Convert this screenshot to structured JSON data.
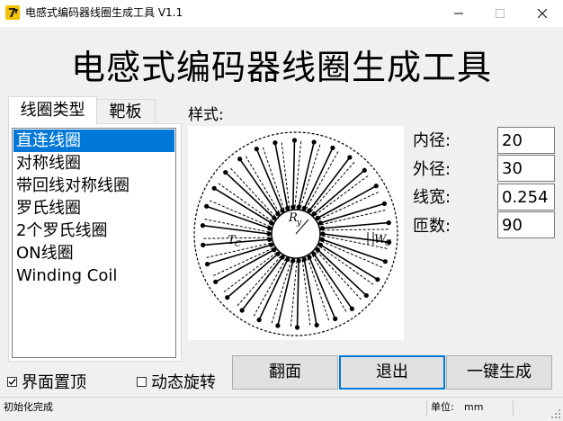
{
  "window": {
    "title": "电感式编码器线圈生成工具 V1.1",
    "controls": {
      "minimize_icon": "minimize-icon",
      "maximize_icon": "maximize-icon",
      "close_icon": "close-icon"
    }
  },
  "heading": "电感式编码器线圈生成工具",
  "tabs": [
    {
      "label": "线圈类型",
      "active": true
    },
    {
      "label": "靶板",
      "active": false
    }
  ],
  "coil_types": [
    {
      "label": "直连线圈",
      "selected": true
    },
    {
      "label": "对称线圈",
      "selected": false
    },
    {
      "label": "带回线对称线圈",
      "selected": false
    },
    {
      "label": "罗氏线圈",
      "selected": false
    },
    {
      "label": "2个罗氏线圈",
      "selected": false
    },
    {
      "label": "ON线圈",
      "selected": false
    },
    {
      "label": "Winding Coil",
      "selected": false
    }
  ],
  "preview": {
    "label": "样式:",
    "annotations": {
      "radius": "R",
      "radius_sub": "y",
      "trace": "T",
      "trace_sub": "C",
      "width": "W",
      "width_sub": "C"
    }
  },
  "params": {
    "inner_diameter": {
      "label": "内径:",
      "value": "20"
    },
    "outer_diameter": {
      "label": "外径:",
      "value": "30"
    },
    "line_width": {
      "label": "线宽:",
      "value": "0.254"
    },
    "turns": {
      "label": "匝数:",
      "value": "90"
    }
  },
  "buttons": {
    "flip": "翻面",
    "exit": "退出",
    "generate": "一键生成"
  },
  "checkboxes": {
    "topmost": {
      "label": "界面置顶",
      "checked": true
    },
    "rotate": {
      "label": "动态旋转",
      "checked": false
    }
  },
  "status": {
    "message": "初始化完成",
    "unit_label": "单位:",
    "unit_value": "mm"
  },
  "colors": {
    "selection": "#0078d7",
    "icon_yellow": "#f2c200",
    "accent_border": "#0078d7"
  }
}
